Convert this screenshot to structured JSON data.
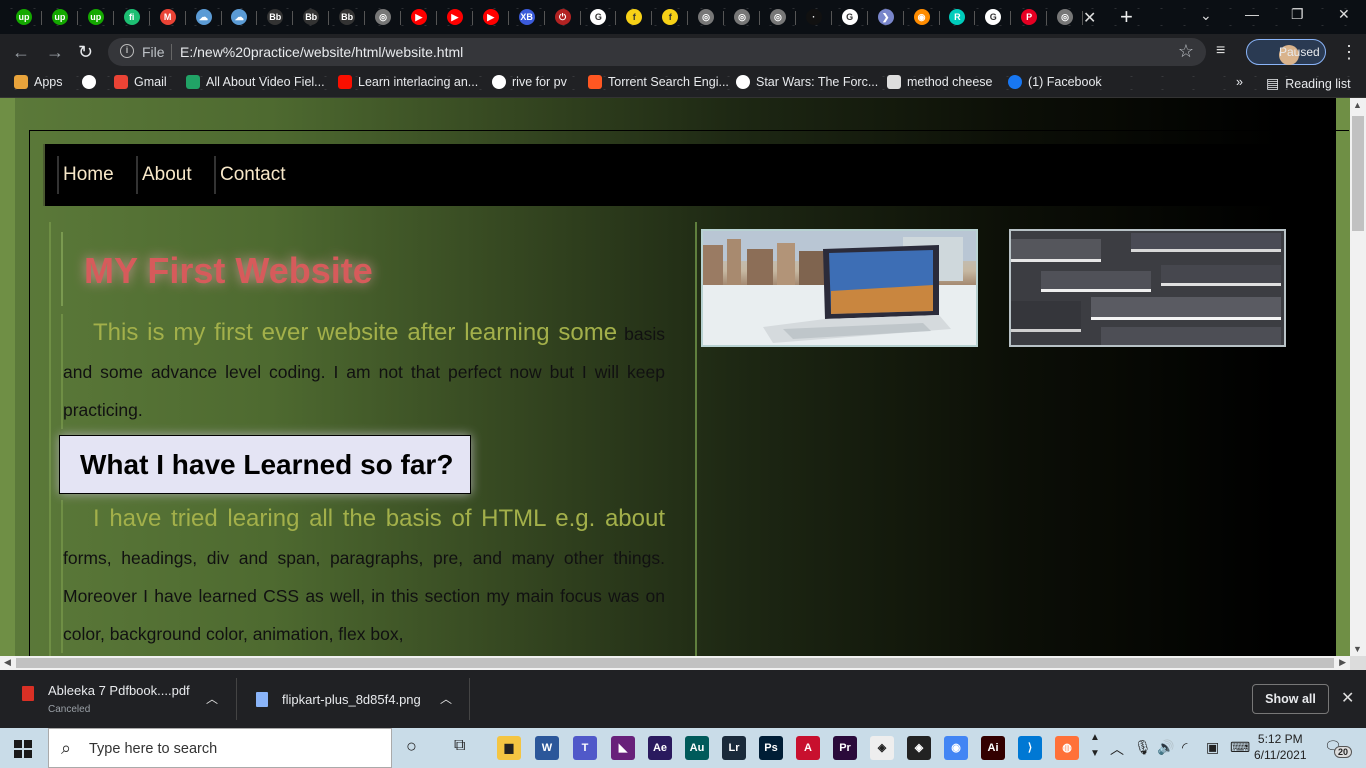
{
  "browser": {
    "tabs": [
      {
        "icon": "upwork-icon",
        "color": "#14a800",
        "glyph": "up"
      },
      {
        "icon": "upwork-icon",
        "color": "#14a800",
        "glyph": "up"
      },
      {
        "icon": "upwork-icon",
        "color": "#14a800",
        "glyph": "up"
      },
      {
        "icon": "fiverr-icon",
        "color": "#1dbf73",
        "glyph": "fi"
      },
      {
        "icon": "gmail-icon",
        "color": "#ea4335",
        "glyph": "M"
      },
      {
        "icon": "cloud-icon",
        "color": "#5b9bd5",
        "glyph": "☁"
      },
      {
        "icon": "cloud-icon",
        "color": "#5b9bd5",
        "glyph": "☁"
      },
      {
        "icon": "blackboard-icon",
        "color": "#333333",
        "glyph": "Bb"
      },
      {
        "icon": "blackboard-icon",
        "color": "#333333",
        "glyph": "Bb"
      },
      {
        "icon": "blackboard-icon",
        "color": "#333333",
        "glyph": "Bb"
      },
      {
        "icon": "globe-icon",
        "color": "#777777",
        "glyph": "◎"
      },
      {
        "icon": "youtube-icon",
        "color": "#ff0000",
        "glyph": "▶"
      },
      {
        "icon": "youtube-icon",
        "color": "#ff0000",
        "glyph": "▶"
      },
      {
        "icon": "youtube-icon",
        "color": "#ff0000",
        "glyph": "▶"
      },
      {
        "icon": "xb-icon",
        "color": "#3b5bdb",
        "glyph": "XB"
      },
      {
        "icon": "power-icon",
        "color": "#b22222",
        "glyph": "⏻"
      },
      {
        "icon": "google-icon",
        "color": "#ffffff",
        "glyph": "G"
      },
      {
        "icon": "flipkart-icon",
        "color": "#f7d117",
        "glyph": "f"
      },
      {
        "icon": "flipkart-icon",
        "color": "#f7d117",
        "glyph": "f"
      },
      {
        "icon": "globe-icon",
        "color": "#777777",
        "glyph": "◎"
      },
      {
        "icon": "globe-icon",
        "color": "#777777",
        "glyph": "◎"
      },
      {
        "icon": "globe-icon",
        "color": "#777777",
        "glyph": "◎"
      },
      {
        "icon": "blank-icon",
        "color": "#111111",
        "glyph": "·"
      },
      {
        "icon": "google-icon",
        "color": "#ffffff",
        "glyph": "G"
      },
      {
        "icon": "arrow-icon",
        "color": "#7986cb",
        "glyph": "❯"
      },
      {
        "icon": "eye-icon",
        "color": "#ff8c00",
        "glyph": "◉"
      },
      {
        "icon": "researchgate-icon",
        "color": "#00ccbb",
        "glyph": "R"
      },
      {
        "icon": "google-icon",
        "color": "#ffffff",
        "glyph": "G"
      },
      {
        "icon": "pinterest-icon",
        "color": "#e60023",
        "glyph": "P"
      },
      {
        "icon": "globe-icon",
        "color": "#777777",
        "glyph": "◎"
      }
    ],
    "url_scheme_label": "File",
    "url": "E:/new%20practice/website/html/website.html",
    "profile_status": "Paused"
  },
  "bookmarks": [
    {
      "label": "Apps",
      "icon": "apps-grid-icon",
      "color": "#e8a33b"
    },
    {
      "label": "",
      "icon": "globe-icon",
      "color": "#ffffff"
    },
    {
      "label": "Gmail",
      "icon": "gmail-icon",
      "color": "#ea4335"
    },
    {
      "label": "All About Video Fiel...",
      "icon": "green-doc-icon",
      "color": "#21a366"
    },
    {
      "label": "Learn interlacing an...",
      "icon": "adobe-icon",
      "color": "#fa0f00"
    },
    {
      "label": "rive for pv",
      "icon": "globe-icon",
      "color": "#ffffff"
    },
    {
      "label": "Torrent Search Engi...",
      "icon": "x-icon",
      "color": "#ff5722"
    },
    {
      "label": "Star Wars: The Forc...",
      "icon": "google-icon",
      "color": "#ffffff"
    },
    {
      "label": "method cheese",
      "icon": "doc-icon",
      "color": "#dddddd"
    },
    {
      "label": "(1) Facebook",
      "icon": "facebook-icon",
      "color": "#1877f2"
    }
  ],
  "bookmarks_overflow": "»",
  "reading_list": "Reading list",
  "page": {
    "nav": [
      "Home",
      "About",
      "Contact"
    ],
    "title": "MY First Website",
    "intro_lead": "This is my first ever website after learning some",
    "intro_rest": "basis and some advance level coding. I am not that perfect now but I will keep practicing.",
    "learned_heading": "What I have Learned so far?",
    "learned_lead": "I have tried learing all the basis of HTML e.g. about",
    "learned_rest": "forms, headings, div and span, paragraphs, pre, and many other things. Moreover I have learned CSS as well, in this section my main focus was on color, background color, animation, flex box,"
  },
  "downloads": [
    {
      "name": "Ableeka 7 Pdfbook....pdf",
      "status": "Canceled",
      "type": "pdf"
    },
    {
      "name": "flipkart-plus_8d85f4.png",
      "status": "",
      "type": "png"
    }
  ],
  "show_all": "Show all",
  "taskbar": {
    "search_placeholder": "Type here to search",
    "apps": [
      {
        "icon": "file-explorer-icon",
        "color": "#f4c542",
        "glyph": "▆"
      },
      {
        "icon": "word-icon",
        "color": "#2b579a",
        "glyph": "W"
      },
      {
        "icon": "teams-icon",
        "color": "#5059c9",
        "glyph": "T"
      },
      {
        "icon": "visual-studio-icon",
        "color": "#68217a",
        "glyph": "◣"
      },
      {
        "icon": "after-effects-icon",
        "color": "#2a1a5e",
        "glyph": "Ae"
      },
      {
        "icon": "audition-icon",
        "color": "#005a5a",
        "glyph": "Au"
      },
      {
        "icon": "lightroom-icon",
        "color": "#1a2a3a",
        "glyph": "Lr"
      },
      {
        "icon": "photoshop-icon",
        "color": "#001e36",
        "glyph": "Ps"
      },
      {
        "icon": "acrobat-icon",
        "color": "#c8102e",
        "glyph": "A"
      },
      {
        "icon": "premiere-icon",
        "color": "#2a0a3a",
        "glyph": "Pr"
      },
      {
        "icon": "unity-icon",
        "color": "#eeeeee",
        "glyph": "◈"
      },
      {
        "icon": "unity-icon",
        "color": "#222222",
        "glyph": "◈"
      },
      {
        "icon": "chrome-icon",
        "color": "#4285f4",
        "glyph": "◉"
      },
      {
        "icon": "illustrator-icon",
        "color": "#330000",
        "glyph": "Ai"
      },
      {
        "icon": "vscode-icon",
        "color": "#0078d4",
        "glyph": "⟩"
      },
      {
        "icon": "firefox-icon",
        "color": "#ff7139",
        "glyph": "◍"
      }
    ],
    "time": "5:12 PM",
    "date": "6/11/2021",
    "notification_count": "20"
  }
}
